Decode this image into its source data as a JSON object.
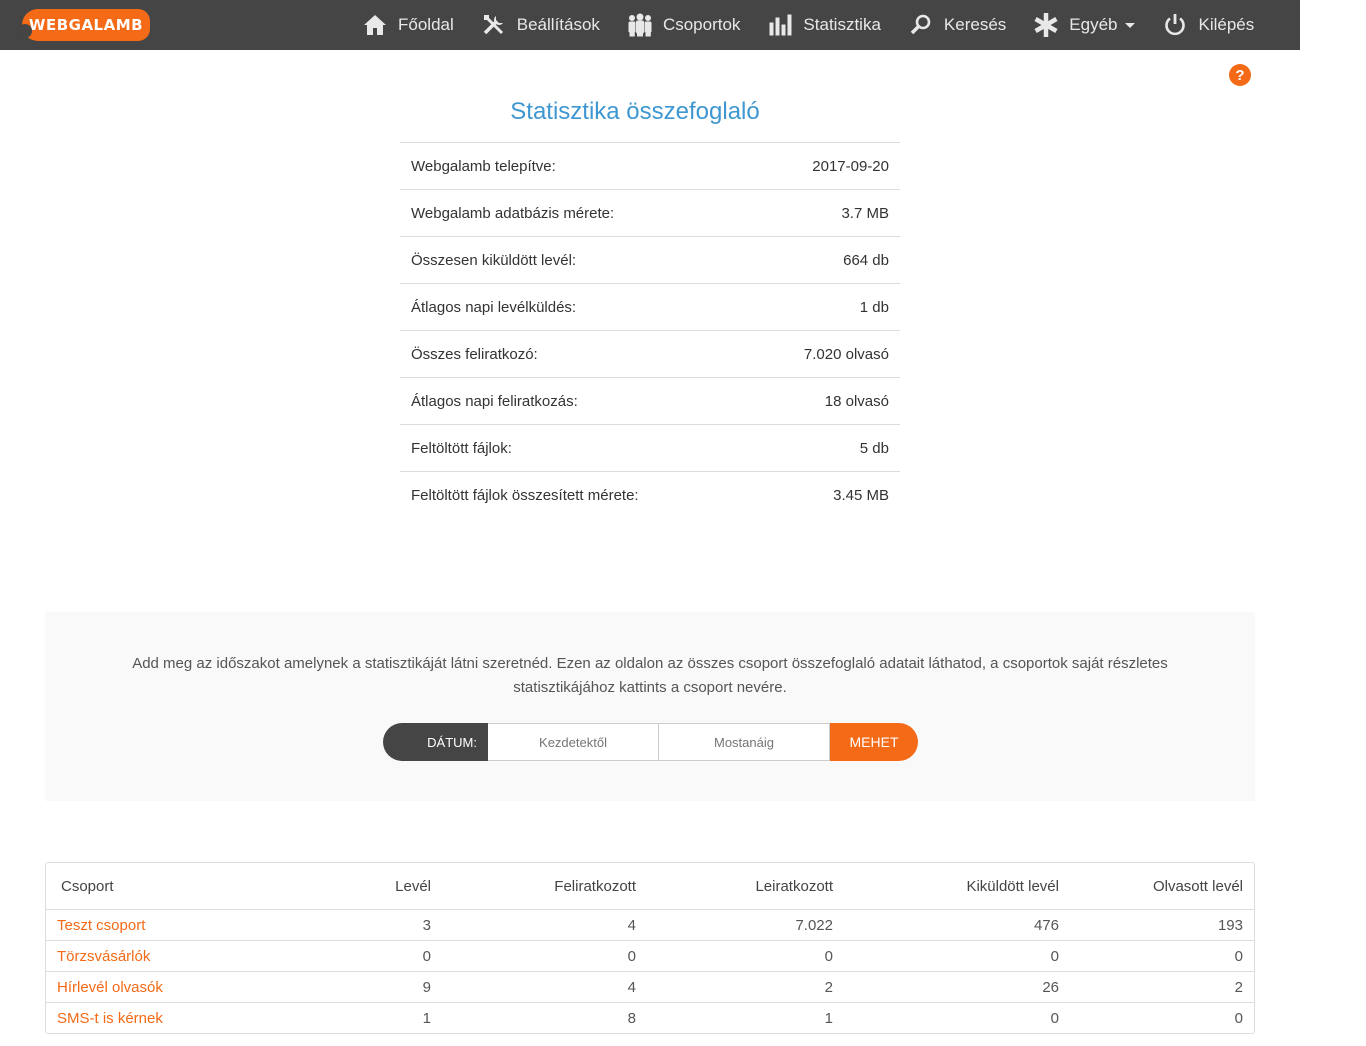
{
  "nav": {
    "logo": "WEBGALAMB",
    "items": [
      {
        "label": "Főoldal",
        "icon": "home-icon"
      },
      {
        "label": "Beállítások",
        "icon": "tools-icon"
      },
      {
        "label": "Csoportok",
        "icon": "users-icon"
      },
      {
        "label": "Statisztika",
        "icon": "bar-chart-icon"
      },
      {
        "label": "Keresés",
        "icon": "search-icon"
      },
      {
        "label": "Egyéb",
        "icon": "asterisk-icon"
      },
      {
        "label": "Kilépés",
        "icon": "power-icon"
      }
    ]
  },
  "help": {
    "symbol": "?"
  },
  "title": "Statisztika összefoglaló",
  "summary": [
    {
      "label": "Webgalamb telepítve:",
      "value": "2017-09-20"
    },
    {
      "label": "Webgalamb adatbázis mérete:",
      "value": "3.7 MB"
    },
    {
      "label": "Összesen kiküldött levél:",
      "value": "664 db"
    },
    {
      "label": "Átlagos napi levélküldés:",
      "value": "1 db"
    },
    {
      "label": "Összes feliratkozó:",
      "value": "7.020 olvasó"
    },
    {
      "label": "Átlagos napi feliratkozás:",
      "value": "18 olvasó"
    },
    {
      "label": "Feltöltött fájlok:",
      "value": "5 db"
    },
    {
      "label": "Feltöltött fájlok összesített mérete:",
      "value": "3.45 MB"
    }
  ],
  "filter": {
    "text": "Add meg az időszakot amelynek a statisztikáját látni szeretnéd. Ezen az oldalon az összes csoport összefoglaló adatait láthatod, a csoportok saját részletes statisztikájához kattints a csoport nevére.",
    "date_label": "DÁTUM:",
    "from_placeholder": "Kezdetektől",
    "to_placeholder": "Mostanáig",
    "go_label": "MEHET"
  },
  "groups": {
    "headers": [
      "Csoport",
      "Levél",
      "Feliratkozott",
      "Leiratkozott",
      "Kiküldött levél",
      "Olvasott levél"
    ],
    "rows": [
      [
        "Teszt csoport",
        "3",
        "4",
        "7.022",
        "476",
        "193"
      ],
      [
        "Törzsvásárlók",
        "0",
        "0",
        "0",
        "0",
        "0"
      ],
      [
        "Hírlevél olvasók",
        "9",
        "4",
        "2",
        "26",
        "2"
      ],
      [
        "SMS-t is kérnek",
        "1",
        "8",
        "1",
        "0",
        "0"
      ]
    ]
  },
  "colors": {
    "accent": "#f46a16",
    "navbar": "#454545",
    "title": "#3e97d1"
  }
}
